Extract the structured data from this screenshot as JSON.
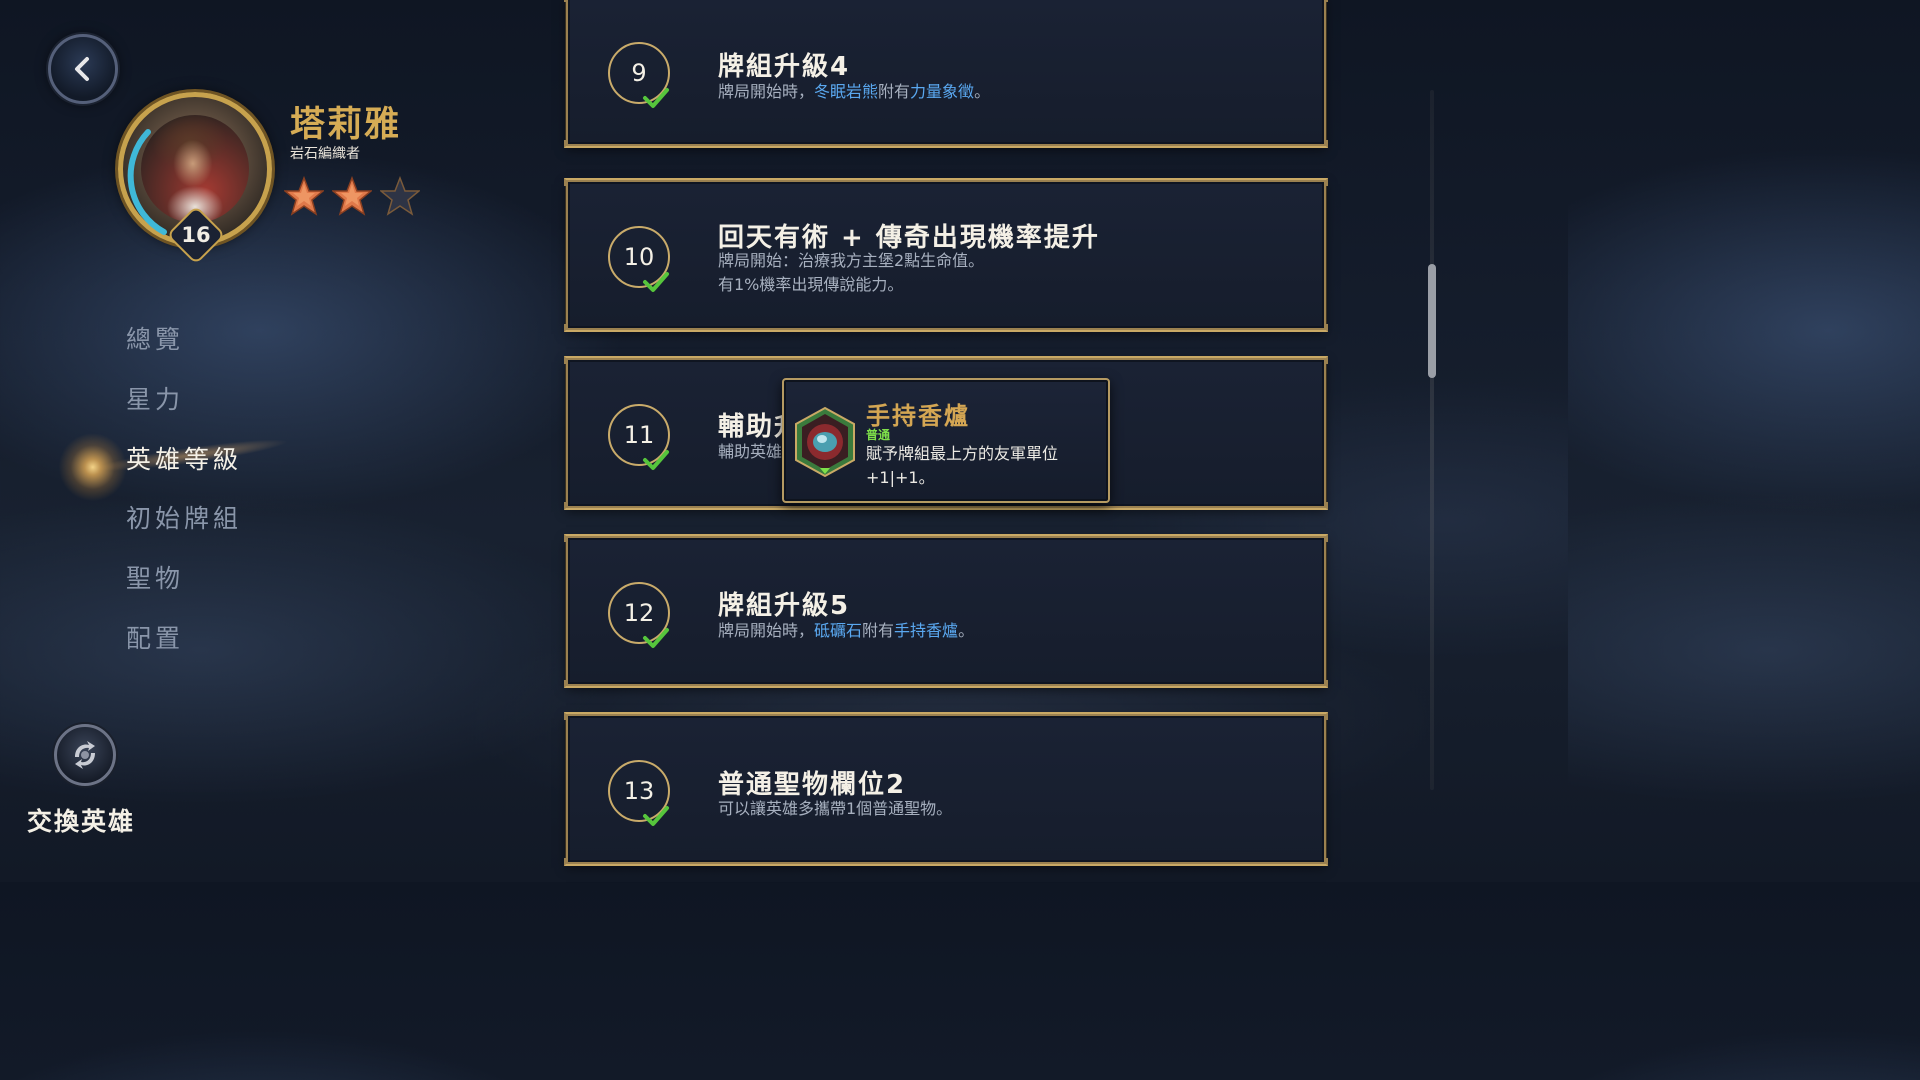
{
  "champion": {
    "name": "塔莉雅",
    "title": "岩石編織者",
    "level": "16",
    "stars_earned": 2,
    "stars_total": 3
  },
  "nav": {
    "items": [
      {
        "label": "總覽",
        "active": false
      },
      {
        "label": "星力",
        "active": false
      },
      {
        "label": "英雄等級",
        "active": true
      },
      {
        "label": "初始牌組",
        "active": false
      },
      {
        "label": "聖物",
        "active": false
      },
      {
        "label": "配置",
        "active": false
      }
    ]
  },
  "swap": {
    "label": "交換英雄"
  },
  "levels": [
    {
      "number": "9",
      "title": "牌組升級4",
      "desc_lines": [
        [
          {
            "text": "牌局開始時，",
            "kw": false
          },
          {
            "text": "冬眠岩熊",
            "kw": true
          },
          {
            "text": "附有",
            "kw": false
          },
          {
            "text": "力量象徵",
            "kw": true
          },
          {
            "text": "。",
            "kw": false
          }
        ]
      ]
    },
    {
      "number": "10",
      "title": "回天有術 + 傳奇出現機率提升",
      "desc_lines": [
        [
          {
            "text": "牌局開始：治療我方主堡2點生命值。",
            "kw": false
          }
        ],
        [
          {
            "text": "有1%機率出現傳說能力。",
            "kw": false
          }
        ]
      ]
    },
    {
      "number": "11",
      "title": "輔助升",
      "desc_lines": [
        [
          {
            "text": "輔助英雄",
            "kw": false
          }
        ]
      ]
    },
    {
      "number": "12",
      "title": "牌組升級5",
      "desc_lines": [
        [
          {
            "text": "牌局開始時，",
            "kw": false
          },
          {
            "text": "砥礪石",
            "kw": true
          },
          {
            "text": "附有",
            "kw": false
          },
          {
            "text": "手持香爐",
            "kw": true
          },
          {
            "text": "。",
            "kw": false
          }
        ]
      ]
    },
    {
      "number": "13",
      "title": "普通聖物欄位2",
      "desc_lines": [
        [
          {
            "text": "可以讓英雄多攜帶1個普通聖物。",
            "kw": false
          }
        ]
      ]
    }
  ],
  "tooltip": {
    "name": "手持香爐",
    "rarity": "普通",
    "description": "賦予牌組最上方的友軍單位+1|+1。",
    "icon": "censer-relic-icon"
  },
  "colors": {
    "gold": "#d6ac55",
    "keyword": "#5aa8f0",
    "check": "#56c53c",
    "rarity_common": "#7fe04a"
  }
}
